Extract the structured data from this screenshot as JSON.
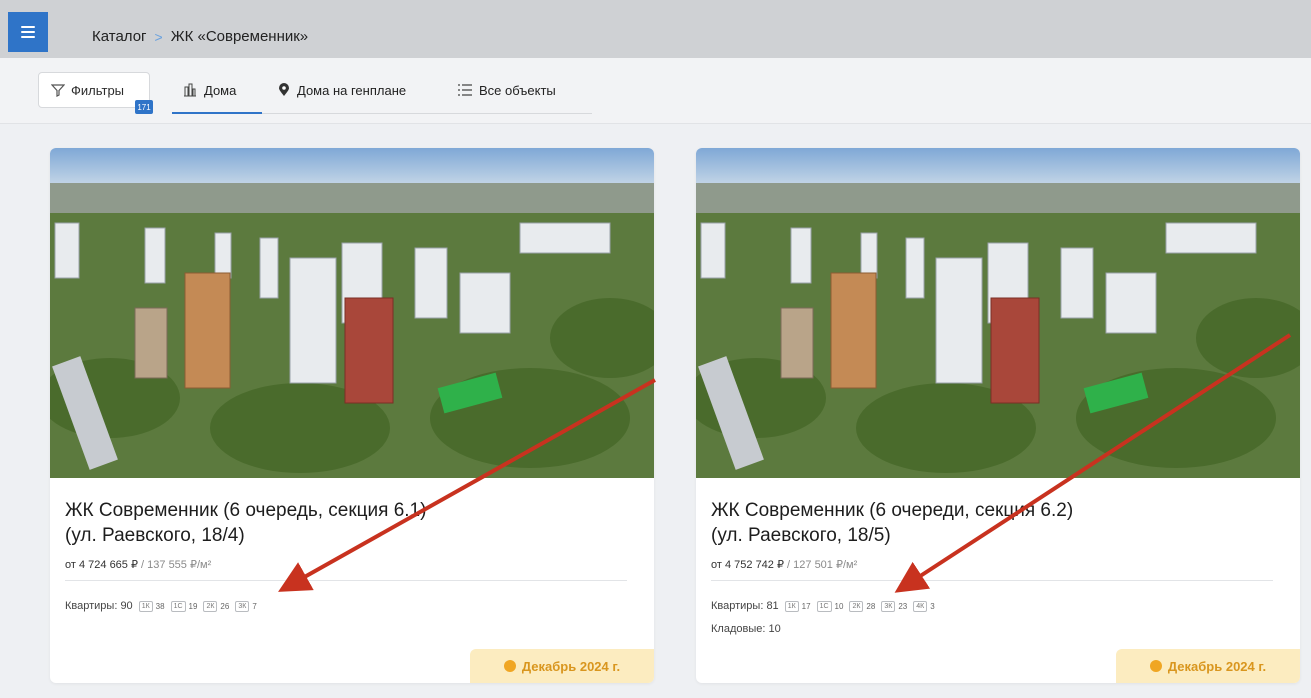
{
  "breadcrumb": {
    "root": "Каталог",
    "separator": ">",
    "current": "ЖК «Современник»"
  },
  "toolbar": {
    "filters_label": "Фильтры",
    "filters_count": "171",
    "tabs": [
      {
        "label": "Дома",
        "icon": "building-icon",
        "active": true
      },
      {
        "label": "Дома на генплане",
        "icon": "map-pin-icon",
        "active": false
      },
      {
        "label": "Все объекты",
        "icon": "list-icon",
        "active": false
      }
    ]
  },
  "cards": [
    {
      "title_line1": "ЖК Современник (6 очередь, секция 6.1)",
      "title_line2": "(ул. Раевского, 18/4)",
      "price_prefix": "от",
      "price": "4 724 665 ₽",
      "price_per_m2": "/ 137 555 ₽/м²",
      "apartments_label": "Квартиры: 90",
      "rooms": [
        {
          "tag": "1К",
          "count": "38"
        },
        {
          "tag": "1С",
          "count": "19"
        },
        {
          "tag": "2К",
          "count": "26"
        },
        {
          "tag": "3К",
          "count": "7"
        }
      ],
      "storage": "",
      "deadline": "Декабрь 2024 г."
    },
    {
      "title_line1": "ЖК Современник (6 очереди, секция 6.2)",
      "title_line2": "(ул. Раевского, 18/5)",
      "price_prefix": "от",
      "price": "4 752 742 ₽",
      "price_per_m2": "/ 127 501 ₽/м²",
      "apartments_label": "Квартиры: 81",
      "rooms": [
        {
          "tag": "1К",
          "count": "17"
        },
        {
          "tag": "1С",
          "count": "10"
        },
        {
          "tag": "2К",
          "count": "28"
        },
        {
          "tag": "3К",
          "count": "23"
        },
        {
          "tag": "4К",
          "count": "3"
        }
      ],
      "storage": "Кладовые: 10",
      "deadline": "Декабрь 2024 г."
    }
  ],
  "colors": {
    "accent": "#2f74c8",
    "deadline_bg": "#fcecc0",
    "deadline_text": "#d9961e",
    "arrow": "#c8321f"
  }
}
